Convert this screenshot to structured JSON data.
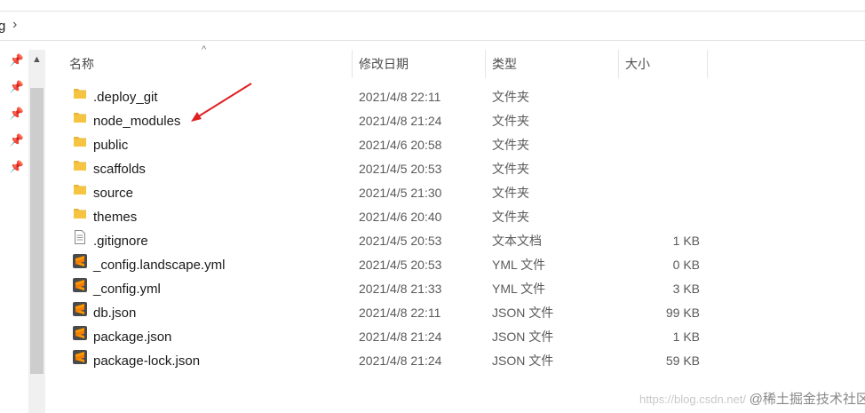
{
  "address": {
    "crumb": "g",
    "separator": "›"
  },
  "columns": {
    "name": "名称",
    "date": "修改日期",
    "type": "类型",
    "size": "大小"
  },
  "files": [
    {
      "name": ".deploy_git",
      "date": "2021/4/8 22:11",
      "type": "文件夹",
      "size": "",
      "icon": "folder-icon"
    },
    {
      "name": "node_modules",
      "date": "2021/4/8 21:24",
      "type": "文件夹",
      "size": "",
      "icon": "folder-icon"
    },
    {
      "name": "public",
      "date": "2021/4/6 20:58",
      "type": "文件夹",
      "size": "",
      "icon": "folder-icon"
    },
    {
      "name": "scaffolds",
      "date": "2021/4/5 20:53",
      "type": "文件夹",
      "size": "",
      "icon": "folder-icon"
    },
    {
      "name": "source",
      "date": "2021/4/5 21:30",
      "type": "文件夹",
      "size": "",
      "icon": "folder-icon"
    },
    {
      "name": "themes",
      "date": "2021/4/6 20:40",
      "type": "文件夹",
      "size": "",
      "icon": "folder-icon"
    },
    {
      "name": ".gitignore",
      "date": "2021/4/5 20:53",
      "type": "文本文档",
      "size": "1 KB",
      "icon": "text-file-icon"
    },
    {
      "name": "_config.landscape.yml",
      "date": "2021/4/5 20:53",
      "type": "YML 文件",
      "size": "0 KB",
      "icon": "sublime-file-icon"
    },
    {
      "name": "_config.yml",
      "date": "2021/4/8 21:33",
      "type": "YML 文件",
      "size": "3 KB",
      "icon": "sublime-file-icon"
    },
    {
      "name": "db.json",
      "date": "2021/4/8 22:11",
      "type": "JSON 文件",
      "size": "99 KB",
      "icon": "sublime-file-icon"
    },
    {
      "name": "package.json",
      "date": "2021/4/8 21:24",
      "type": "JSON 文件",
      "size": "1 KB",
      "icon": "sublime-file-icon"
    },
    {
      "name": "package-lock.json",
      "date": "2021/4/8 21:24",
      "type": "JSON 文件",
      "size": "59 KB",
      "icon": "sublime-file-icon"
    }
  ],
  "watermark": {
    "url": "https://blog.csdn.net/",
    "brand": "@稀土掘金技术社区"
  },
  "colors": {
    "folder": "#f5c542",
    "sublime": "#ff9800",
    "annotation": "#e02020"
  }
}
